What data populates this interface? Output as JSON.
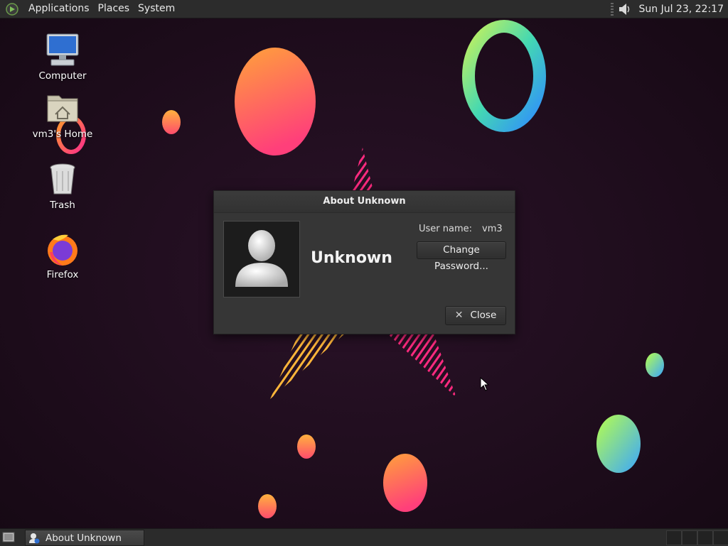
{
  "top_panel": {
    "menus": [
      "Applications",
      "Places",
      "System"
    ],
    "clock": "Sun Jul 23, 22:17",
    "icons": {
      "menu_logo": "distro-logo-icon",
      "volume": "speaker-icon"
    }
  },
  "desktop_icons": [
    {
      "label": "Computer",
      "icon": "computer-icon"
    },
    {
      "label": "vm3's Home",
      "icon": "home-folder-icon"
    },
    {
      "label": "Trash",
      "icon": "trash-icon"
    },
    {
      "label": "Firefox",
      "icon": "firefox-icon"
    }
  ],
  "dialog": {
    "title": "About Unknown",
    "display_name": "Unknown",
    "user_name_label": "User name:",
    "user_name_value": "vm3",
    "change_password_label": "Change Password...",
    "close_label": "Close",
    "avatar_icon": "user-avatar-icon"
  },
  "taskbar": {
    "window_button_label": "About Unknown",
    "show_desktop_icon": "show-desktop-icon"
  },
  "colors": {
    "wallpaper_bg": "#1e0d1c",
    "panel_bg": "#2c2c2c",
    "dialog_bg": "#363636"
  }
}
